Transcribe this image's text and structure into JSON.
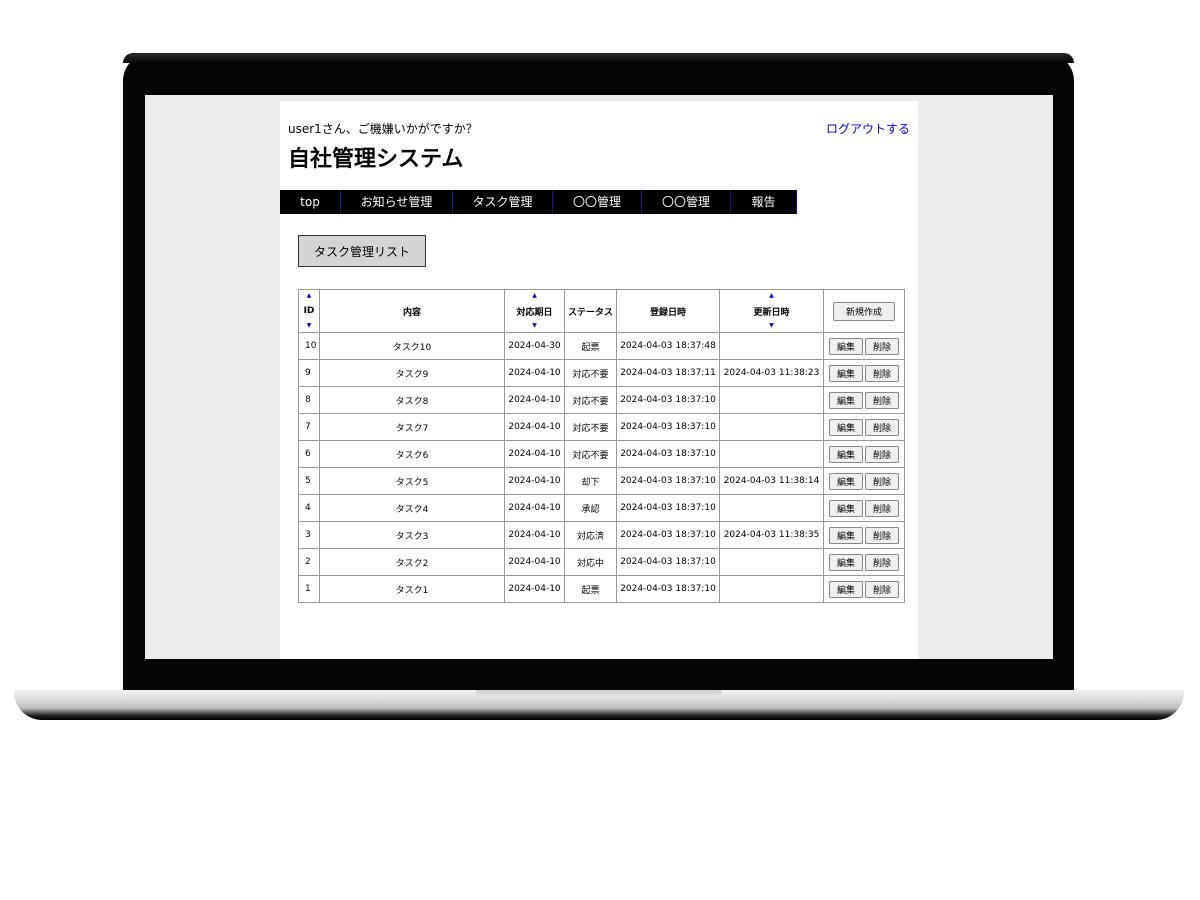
{
  "header": {
    "greeting": "user1さん、ご機嫌いかがですか？",
    "logout_label": "ログアウトする",
    "title": "自社管理システム"
  },
  "nav": [
    {
      "label": "top"
    },
    {
      "label": "お知らせ管理"
    },
    {
      "label": "タスク管理"
    },
    {
      "label": "〇〇管理"
    },
    {
      "label": "〇〇管理"
    },
    {
      "label": "報告"
    }
  ],
  "list_button_label": "タスク管理リスト",
  "table": {
    "headers": {
      "id": "ID",
      "content": "内容",
      "due": "対応期日",
      "status": "ステータス",
      "created": "登録日時",
      "updated": "更新日時"
    },
    "new_label": "新規作成",
    "edit_label": "編集",
    "delete_label": "削除",
    "rows": [
      {
        "id": "10",
        "content": "タスク10",
        "due": "2024-04-30",
        "status": "起票",
        "created": "2024-04-03 18:37:48",
        "updated": ""
      },
      {
        "id": "9",
        "content": "タスク9",
        "due": "2024-04-10",
        "status": "対応不要",
        "created": "2024-04-03 18:37:11",
        "updated": "2024-04-03 11:38:23"
      },
      {
        "id": "8",
        "content": "タスク8",
        "due": "2024-04-10",
        "status": "対応不要",
        "created": "2024-04-03 18:37:10",
        "updated": ""
      },
      {
        "id": "7",
        "content": "タスク7",
        "due": "2024-04-10",
        "status": "対応不要",
        "created": "2024-04-03 18:37:10",
        "updated": ""
      },
      {
        "id": "6",
        "content": "タスク6",
        "due": "2024-04-10",
        "status": "対応不要",
        "created": "2024-04-03 18:37:10",
        "updated": ""
      },
      {
        "id": "5",
        "content": "タスク5",
        "due": "2024-04-10",
        "status": "却下",
        "created": "2024-04-03 18:37:10",
        "updated": "2024-04-03 11:38:14"
      },
      {
        "id": "4",
        "content": "タスク4",
        "due": "2024-04-10",
        "status": "承認",
        "created": "2024-04-03 18:37:10",
        "updated": ""
      },
      {
        "id": "3",
        "content": "タスク3",
        "due": "2024-04-10",
        "status": "対応済",
        "created": "2024-04-03 18:37:10",
        "updated": "2024-04-03 11:38:35"
      },
      {
        "id": "2",
        "content": "タスク2",
        "due": "2024-04-10",
        "status": "対応中",
        "created": "2024-04-03 18:37:10",
        "updated": ""
      },
      {
        "id": "1",
        "content": "タスク1",
        "due": "2024-04-10",
        "status": "起票",
        "created": "2024-04-03 18:37:10",
        "updated": ""
      }
    ]
  }
}
